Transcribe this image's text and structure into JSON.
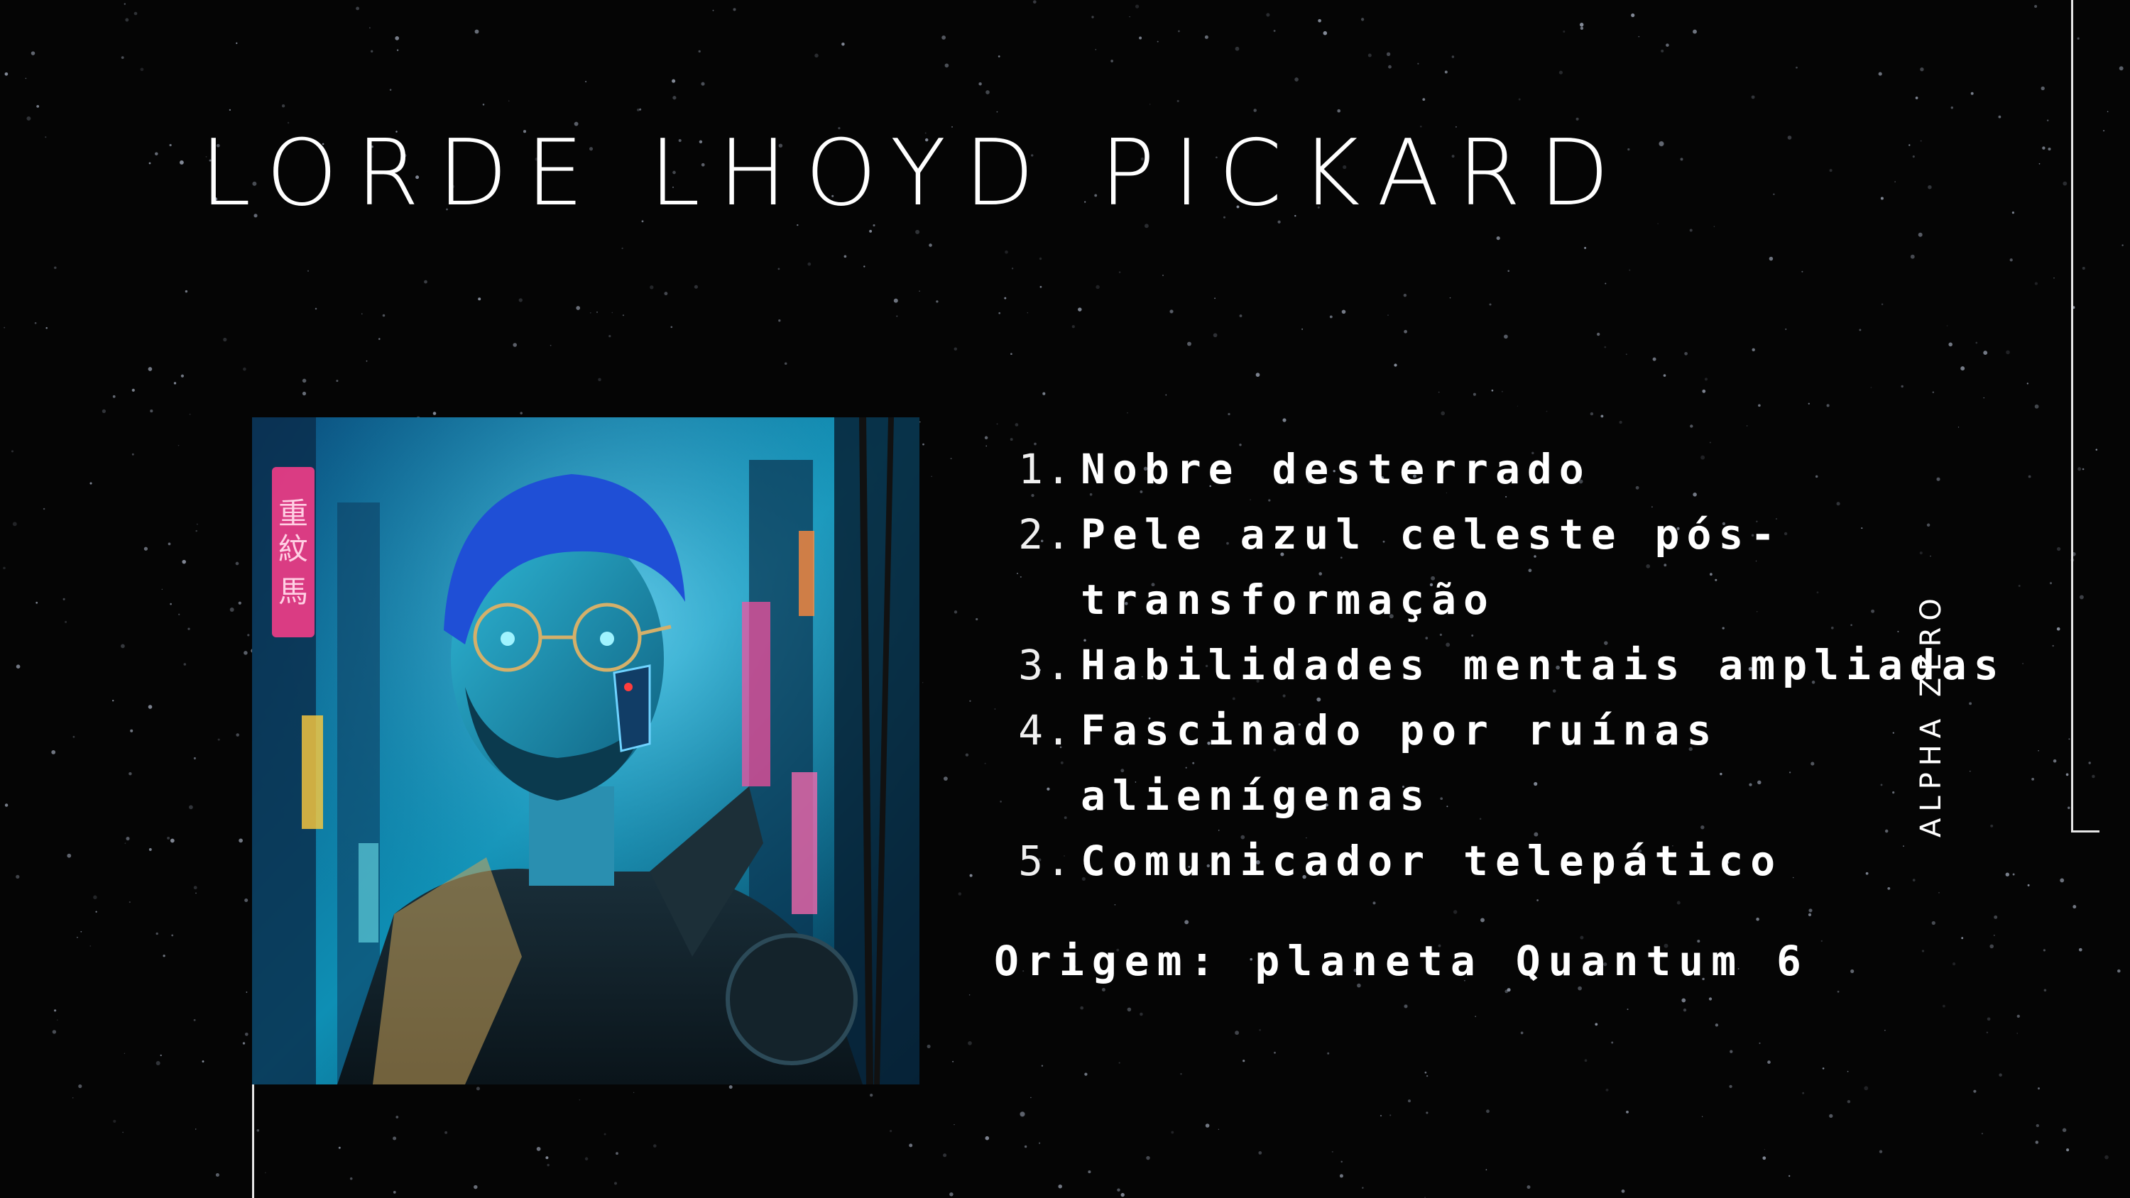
{
  "slide": {
    "title": "LORDE LHOYD PICKARD",
    "side_label": "ALPHA ZERO",
    "portrait": {
      "description_icon": "cyberpunk-portrait-image",
      "sign_text": "重紋\n馬"
    },
    "traits": [
      {
        "number": "1.",
        "text": "Nobre desterrado"
      },
      {
        "number": "2.",
        "text": "Pele azul celeste pós-transformação"
      },
      {
        "number": "3.",
        "text": "Habilidades mentais ampliadas"
      },
      {
        "number": "4.",
        "text": "Fascinado por ruínas alienígenas"
      },
      {
        "number": "5.",
        "text": "Comunicador telepático"
      }
    ],
    "origin": "Origem:  planeta Quantum 6"
  },
  "colors": {
    "background": "#050505",
    "text": "#ffffff",
    "line": "#e6e6e6"
  }
}
